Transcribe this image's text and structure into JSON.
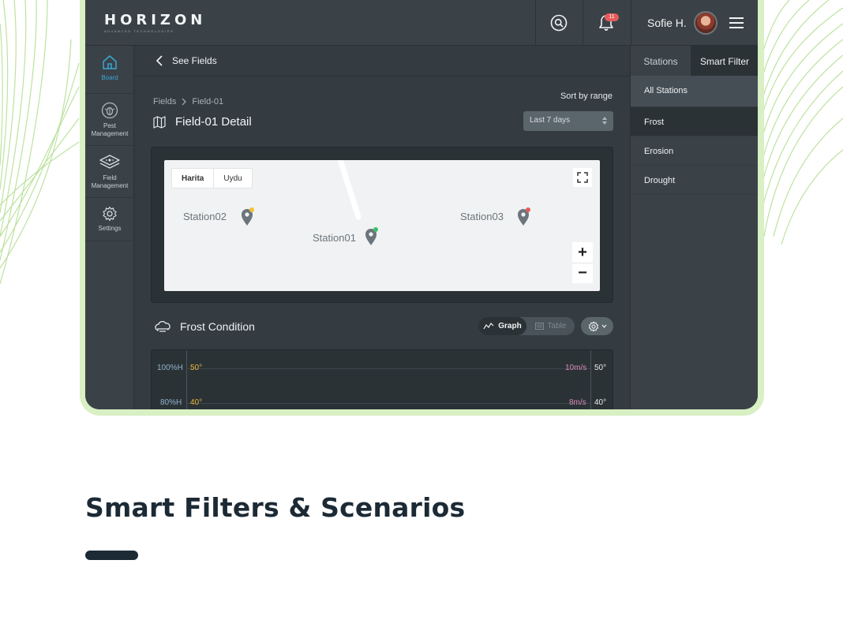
{
  "app": {
    "brand": "HORIZON",
    "brand_tagline": "ADVANCED TECHNOLOGIES",
    "notification_count": "11",
    "user_name": "Sofie H."
  },
  "nav": {
    "items": [
      {
        "label": "Board",
        "icon": "home-icon",
        "active": true
      },
      {
        "label": "Pest Management",
        "icon": "bug-icon",
        "active": false
      },
      {
        "label": "Field Management",
        "icon": "field-icon",
        "active": false
      },
      {
        "label": "Settings",
        "icon": "gear-icon",
        "active": false
      }
    ]
  },
  "subbar": {
    "back_label": "See Fields"
  },
  "breadcrumb": {
    "root": "Fields",
    "current": "Field-01"
  },
  "page": {
    "title": "Field-01 Detail"
  },
  "sort": {
    "label": "Sort by range",
    "value": "Last 7 days"
  },
  "map": {
    "tabs": [
      "Harita",
      "Uydu"
    ],
    "active_tab": "Harita",
    "stations": [
      {
        "name": "Station02",
        "status_color": "#f2c230"
      },
      {
        "name": "Station01",
        "status_color": "#3bbf6a"
      },
      {
        "name": "Station03",
        "status_color": "#e55a5a"
      }
    ],
    "zoom_in": "+",
    "zoom_out": "−"
  },
  "frost": {
    "title": "Frost Condition",
    "view_graph": "Graph",
    "view_table": "Table",
    "active_view": "Graph"
  },
  "chart_data": {
    "type": "line",
    "axes": [
      {
        "name": "humidity",
        "ticks": [
          "100%H",
          "80%H"
        ],
        "color": "#8fb3cf"
      },
      {
        "name": "temperature",
        "ticks": [
          "50°",
          "40°"
        ],
        "color": "#e7b63a"
      },
      {
        "name": "wind",
        "ticks": [
          "10m/s",
          "8m/s"
        ],
        "color": "#d98bb6"
      },
      {
        "name": "temperature-right",
        "ticks": [
          "50°",
          "40°"
        ],
        "color": "#e6ebee"
      }
    ],
    "series": []
  },
  "right_panel": {
    "tabs": [
      "Stations",
      "Smart Filter"
    ],
    "active_tab": "Smart Filter",
    "items": [
      "All Stations",
      "Frost",
      "Erosion",
      "Drought"
    ],
    "selected": "Frost"
  },
  "footer": {
    "headline": "Smart Filters & Scenarios"
  },
  "colors": {
    "accent": "#3aa6d4",
    "panel": "#343c42",
    "frame": "#d9efc4"
  }
}
